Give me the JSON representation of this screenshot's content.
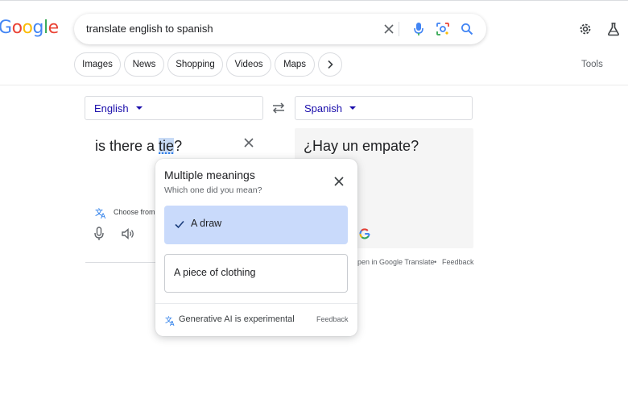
{
  "header": {
    "logo": {
      "letters": [
        "G",
        "o",
        "o",
        "g",
        "l",
        "e"
      ],
      "colors": [
        "#4285f4",
        "#ea4335",
        "#fbbc05",
        "#4285f4",
        "#34a853",
        "#ea4335"
      ]
    },
    "search_query": "translate english to spanish",
    "icons": [
      "close-icon",
      "mic-icon",
      "lens-icon",
      "search-icon",
      "settings-icon",
      "labs-icon"
    ]
  },
  "chips": [
    "Images",
    "News",
    "Shopping",
    "Videos",
    "Maps"
  ],
  "tools_label": "Tools",
  "translate": {
    "source_language": "English",
    "target_language": "Spanish",
    "source_text_before": "is there a ",
    "source_text_highlight": "tie",
    "source_text_after": "?",
    "target_text": "¿Hay un empate?",
    "choose_label": "Choose from",
    "open_link": "pen in Google Translate",
    "separator": "•",
    "feedback": "Feedback"
  },
  "popup": {
    "title": "Multiple meanings",
    "subtitle": "Which one did you mean?",
    "options": [
      {
        "label": "A draw",
        "selected": true
      },
      {
        "label": "A piece of clothing",
        "selected": false
      }
    ],
    "footer_text": "Generative AI is experimental",
    "footer_feedback": "Feedback"
  },
  "colors": {
    "link": "#1a0dab",
    "selected_option": "#c9dafb",
    "icon_blue": "#1a73e8"
  }
}
